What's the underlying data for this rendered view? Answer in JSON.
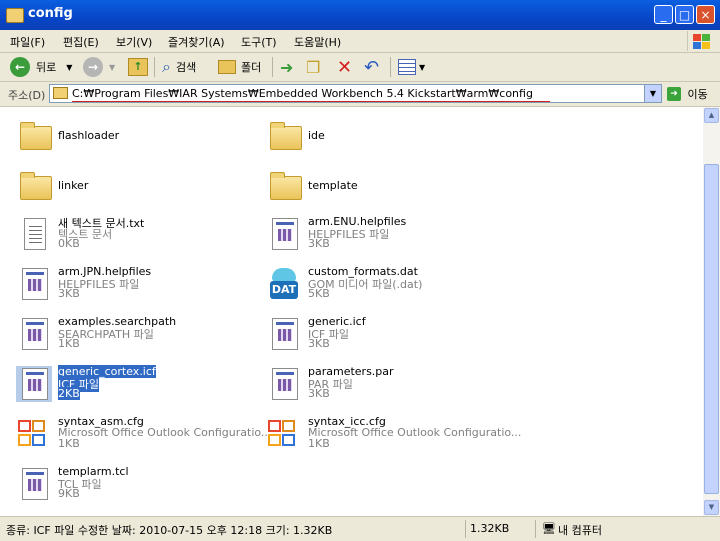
{
  "window": {
    "title": "config"
  },
  "menu": [
    "파일(F)",
    "편집(E)",
    "보기(V)",
    "즐겨찾기(A)",
    "도구(T)",
    "도움말(H)"
  ],
  "toolbar": {
    "back_label": "뒤로",
    "search_label": "검색",
    "folders_label": "폴더"
  },
  "address": {
    "label": "주소(D)",
    "path": "C:₩Program Files₩IAR Systems₩Embedded Workbench 5.4 Kickstart₩arm₩config",
    "go_label": "이동"
  },
  "items": [
    {
      "name": "flashloader",
      "kind": "folder"
    },
    {
      "name": "ide",
      "kind": "folder"
    },
    {
      "name": "linker",
      "kind": "folder"
    },
    {
      "name": "template",
      "kind": "folder"
    },
    {
      "name": "새 텍스트 문서.txt",
      "type": "텍스트 문서",
      "size": "0KB",
      "kind": "txt"
    },
    {
      "name": "arm.ENU.helpfiles",
      "type": "HELPFILES 파일",
      "size": "3KB",
      "kind": "doc"
    },
    {
      "name": "arm.JPN.helpfiles",
      "type": "HELPFILES 파일",
      "size": "3KB",
      "kind": "doc"
    },
    {
      "name": "custom_formats.dat",
      "type": "GOM 미디어 파일(.dat)",
      "size": "5KB",
      "kind": "dat",
      "icon_text": "DAT"
    },
    {
      "name": "examples.searchpath",
      "type": "SEARCHPATH 파일",
      "size": "1KB",
      "kind": "doc"
    },
    {
      "name": "generic.icf",
      "type": "ICF 파일",
      "size": "3KB",
      "kind": "doc"
    },
    {
      "name": "generic_cortex.icf",
      "type": "ICF 파일",
      "size": "2KB",
      "kind": "doc",
      "selected": true
    },
    {
      "name": "parameters.par",
      "type": "PAR 파일",
      "size": "3KB",
      "kind": "doc"
    },
    {
      "name": "syntax_asm.cfg",
      "type": "Microsoft Office Outlook Configuratio...",
      "size": "1KB",
      "kind": "outlook"
    },
    {
      "name": "syntax_icc.cfg",
      "type": "Microsoft Office Outlook Configuratio...",
      "size": "1KB",
      "kind": "outlook"
    },
    {
      "name": "templarm.tcl",
      "type": "TCL 파일",
      "size": "9KB",
      "kind": "doc"
    }
  ],
  "status": {
    "info": "종류: ICF 파일 수정한 날짜: 2010-07-15 오후 12:18 크기: 1.32KB",
    "size": "1.32KB",
    "location": "내 컴퓨터"
  },
  "colors": {
    "titlebar": "#0a5fe0",
    "selection": "#316ac5",
    "chrome": "#ece9d8"
  }
}
